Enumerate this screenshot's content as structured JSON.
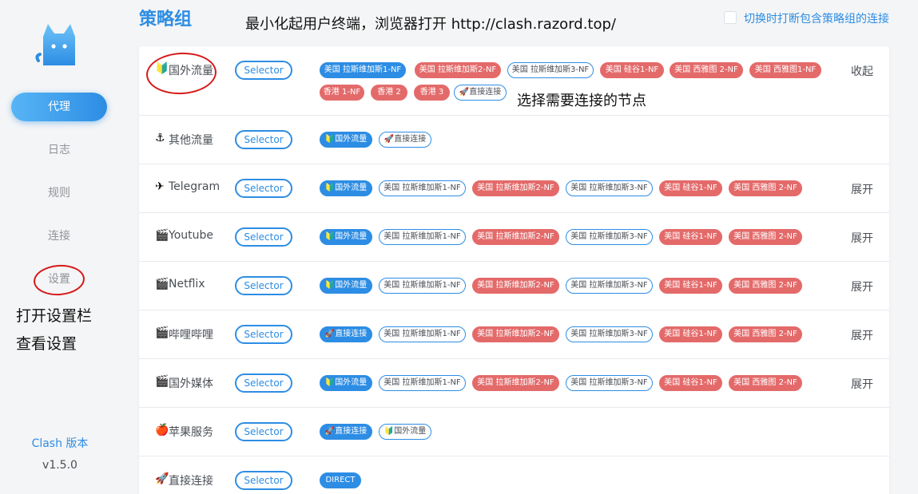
{
  "sidebar": {
    "logo": "cat-logo",
    "items": [
      {
        "label": "代理",
        "active": true
      },
      {
        "label": "日志",
        "active": false
      },
      {
        "label": "规则",
        "active": false
      },
      {
        "label": "连接",
        "active": false
      },
      {
        "label": "设置",
        "active": false
      }
    ],
    "version_label": "Clash 版本",
    "version": "v1.5.0"
  },
  "header": {
    "title": "策略组",
    "switch_label": "切换时打断包含策略组的连接"
  },
  "annotations": {
    "top": "最小化起用户终端，浏览器打开 http://clash.razord.top/",
    "select_node": "选择需要连接的节点",
    "settings_line1": "打开设置栏",
    "settings_line2": "查看设置"
  },
  "groups": [
    {
      "icon": "🔰",
      "name": "国外流量",
      "type": "Selector",
      "toggle": "收起",
      "tags": [
        {
          "label": "美国 拉斯维加斯1-NF",
          "state": "sel"
        },
        {
          "label": "美国 拉斯维加斯2-NF",
          "state": "warn"
        },
        {
          "label": "美国 拉斯维加斯3-NF",
          "state": "norm"
        },
        {
          "label": "美国 硅谷1-NF",
          "state": "warn"
        },
        {
          "label": "美国 西雅图 2-NF",
          "state": "warn"
        },
        {
          "label": "美国 西雅图1-NF",
          "state": "warn"
        },
        {
          "label": "香港 1-NF",
          "state": "warn"
        },
        {
          "label": "香港 2",
          "state": "warn"
        },
        {
          "label": "香港 3",
          "state": "warn"
        },
        {
          "label": "🚀直接连接",
          "state": "norm"
        }
      ]
    },
    {
      "icon": "⚓",
      "name": "其他流量",
      "type": "Selector",
      "toggle": "",
      "tags": [
        {
          "label": "🔰国外流量",
          "state": "sel"
        },
        {
          "label": "🚀直接连接",
          "state": "norm"
        }
      ]
    },
    {
      "icon": "✈",
      "name": "Telegram",
      "type": "Selector",
      "toggle": "展开",
      "tags": [
        {
          "label": "🔰国外流量",
          "state": "sel"
        },
        {
          "label": "美国 拉斯维加斯1-NF",
          "state": "norm"
        },
        {
          "label": "美国 拉斯维加斯2-NF",
          "state": "warn"
        },
        {
          "label": "美国 拉斯维加斯3-NF",
          "state": "norm"
        },
        {
          "label": "美国 硅谷1-NF",
          "state": "warn"
        },
        {
          "label": "美国 西雅图 2-NF",
          "state": "warn"
        }
      ]
    },
    {
      "icon": "🎬",
      "name": "Youtube",
      "type": "Selector",
      "toggle": "展开",
      "tags": [
        {
          "label": "🔰国外流量",
          "state": "sel"
        },
        {
          "label": "美国 拉斯维加斯1-NF",
          "state": "norm"
        },
        {
          "label": "美国 拉斯维加斯2-NF",
          "state": "warn"
        },
        {
          "label": "美国 拉斯维加斯3-NF",
          "state": "norm"
        },
        {
          "label": "美国 硅谷1-NF",
          "state": "warn"
        },
        {
          "label": "美国 西雅图 2-NF",
          "state": "warn"
        }
      ]
    },
    {
      "icon": "🎬",
      "name": "Netflix",
      "type": "Selector",
      "toggle": "展开",
      "tags": [
        {
          "label": "🔰国外流量",
          "state": "sel"
        },
        {
          "label": "美国 拉斯维加斯1-NF",
          "state": "norm"
        },
        {
          "label": "美国 拉斯维加斯2-NF",
          "state": "warn"
        },
        {
          "label": "美国 拉斯维加斯3-NF",
          "state": "norm"
        },
        {
          "label": "美国 硅谷1-NF",
          "state": "warn"
        },
        {
          "label": "美国 西雅图 2-NF",
          "state": "warn"
        }
      ]
    },
    {
      "icon": "🎬",
      "name": "哔哩哔哩",
      "type": "Selector",
      "toggle": "展开",
      "tags": [
        {
          "label": "🚀直接连接",
          "state": "sel"
        },
        {
          "label": "美国 拉斯维加斯1-NF",
          "state": "norm"
        },
        {
          "label": "美国 拉斯维加斯2-NF",
          "state": "warn"
        },
        {
          "label": "美国 拉斯维加斯3-NF",
          "state": "norm"
        },
        {
          "label": "美国 硅谷1-NF",
          "state": "warn"
        },
        {
          "label": "美国 西雅图 2-NF",
          "state": "warn"
        }
      ]
    },
    {
      "icon": "🎬",
      "name": "国外媒体",
      "type": "Selector",
      "toggle": "展开",
      "tags": [
        {
          "label": "🔰国外流量",
          "state": "sel"
        },
        {
          "label": "美国 拉斯维加斯1-NF",
          "state": "norm"
        },
        {
          "label": "美国 拉斯维加斯2-NF",
          "state": "warn"
        },
        {
          "label": "美国 拉斯维加斯3-NF",
          "state": "norm"
        },
        {
          "label": "美国 硅谷1-NF",
          "state": "warn"
        },
        {
          "label": "美国 西雅图 2-NF",
          "state": "warn"
        }
      ]
    },
    {
      "icon": "🍎",
      "name": "苹果服务",
      "type": "Selector",
      "toggle": "",
      "tags": [
        {
          "label": "🚀直接连接",
          "state": "sel"
        },
        {
          "label": "🔰国外流量",
          "state": "norm"
        }
      ]
    },
    {
      "icon": "🚀",
      "name": "直接连接",
      "type": "Selector",
      "toggle": "",
      "tags": [
        {
          "label": "DIRECT",
          "state": "sel"
        }
      ]
    }
  ],
  "colors": {
    "accent": "#2d8de4",
    "warn": "#e46a6a",
    "annotation_red": "#d61a1a"
  }
}
